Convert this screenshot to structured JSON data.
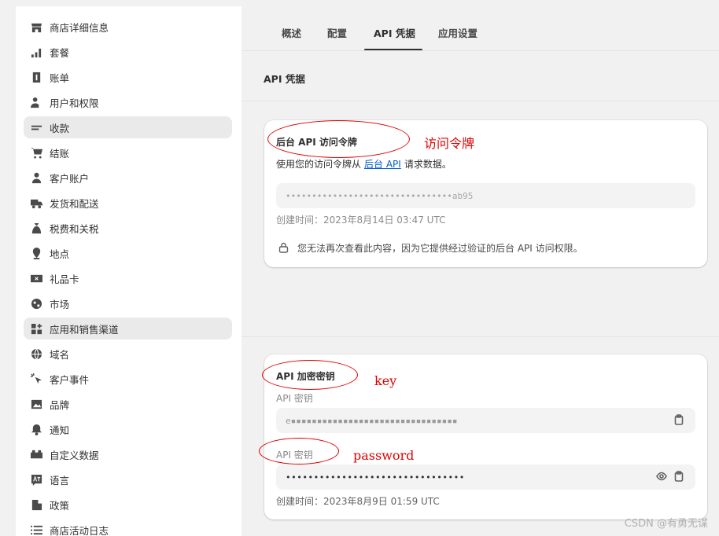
{
  "sidebar": {
    "items": [
      {
        "label": "商店详细信息",
        "icon": "store-icon"
      },
      {
        "label": "套餐",
        "icon": "chart-icon"
      },
      {
        "label": "账单",
        "icon": "dollar-icon"
      },
      {
        "label": "用户和权限",
        "icon": "user-key-icon"
      },
      {
        "label": "收款",
        "icon": "cash-icon"
      },
      {
        "label": "结账",
        "icon": "cart-icon"
      },
      {
        "label": "客户账户",
        "icon": "person-icon"
      },
      {
        "label": "发货和配送",
        "icon": "truck-icon"
      },
      {
        "label": "税费和关税",
        "icon": "tax-icon"
      },
      {
        "label": "地点",
        "icon": "location-icon"
      },
      {
        "label": "礼品卡",
        "icon": "gift-card-icon"
      },
      {
        "label": "市场",
        "icon": "globe-icon"
      },
      {
        "label": "应用和销售渠道",
        "icon": "apps-icon"
      },
      {
        "label": "域名",
        "icon": "domain-icon"
      },
      {
        "label": "客户事件",
        "icon": "pointer-icon"
      },
      {
        "label": "品牌",
        "icon": "image-icon"
      },
      {
        "label": "通知",
        "icon": "bell-icon"
      },
      {
        "label": "自定义数据",
        "icon": "data-icon"
      },
      {
        "label": "语言",
        "icon": "language-icon"
      },
      {
        "label": "政策",
        "icon": "policy-icon"
      },
      {
        "label": "商店活动日志",
        "icon": "list-icon"
      }
    ],
    "active_items": [
      "收款",
      "应用和销售渠道"
    ]
  },
  "tabs": [
    {
      "label": "概述"
    },
    {
      "label": "配置"
    },
    {
      "label": "API 凭据",
      "active": true
    },
    {
      "label": "应用设置"
    }
  ],
  "section_title": "API 凭据",
  "token_card": {
    "title": "后台 API 访问令牌",
    "desc_before": "使用您的访问令牌从",
    "desc_link": "后台 API",
    "desc_after": "请求数据。",
    "token_value": "••••••••••••••••••••••••••••••••ab95",
    "created": "创建时间：2023年8月14日 03:47 UTC",
    "lock_note": "您无法再次查看此内容，因为它提供经过验证的后台 API 访问权限。"
  },
  "key_card": {
    "title": "API 加密密钥",
    "key_label": "API 密钥",
    "key_value": "e▪▪▪▪▪▪▪▪▪▪▪▪▪▪▪▪▪▪▪▪▪▪▪▪▪▪▪▪▪▪▪▪",
    "secret_label": "API 密钥",
    "secret_value": "••••••••••••••••••••••••••••••••",
    "created": "创建时间：2023年8月9日 01:59 UTC"
  },
  "annotations": {
    "token": "访问令牌",
    "key": "key",
    "password": "password",
    "color": "#e00000"
  },
  "watermark": "CSDN @有勇无谋",
  "colors": {
    "link": "#005bd3",
    "active_bg": "#eaeaea"
  }
}
